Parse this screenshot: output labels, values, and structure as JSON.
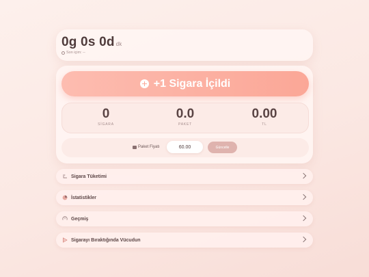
{
  "timer": {
    "value": "0g 0s 0d",
    "unit": "dk",
    "last_smoked": "Son içim: --"
  },
  "smoke_button": {
    "label": "+1 Sigara İçildi"
  },
  "stats": [
    {
      "value": "0",
      "label": "SİGARA"
    },
    {
      "value": "0.0",
      "label": "PAKET"
    },
    {
      "value": "0.00",
      "label": "TL"
    }
  ],
  "price": {
    "label": "Paket Fiyatı",
    "value": "60.00",
    "update_label": "Güncelle"
  },
  "sections": [
    {
      "label": "Sigara Tüketimi",
      "icon": "cigarette-icon"
    },
    {
      "label": "İstatistikler",
      "icon": "pie-chart-icon"
    },
    {
      "label": "Geçmiş",
      "icon": "history-icon"
    },
    {
      "label": "Sigarayı Bıraktığında Vücudun",
      "icon": "body-icon"
    }
  ],
  "colors": {
    "accent": "#fba797",
    "background": "#fdf0ec",
    "update_button": "#dfb3ae"
  }
}
